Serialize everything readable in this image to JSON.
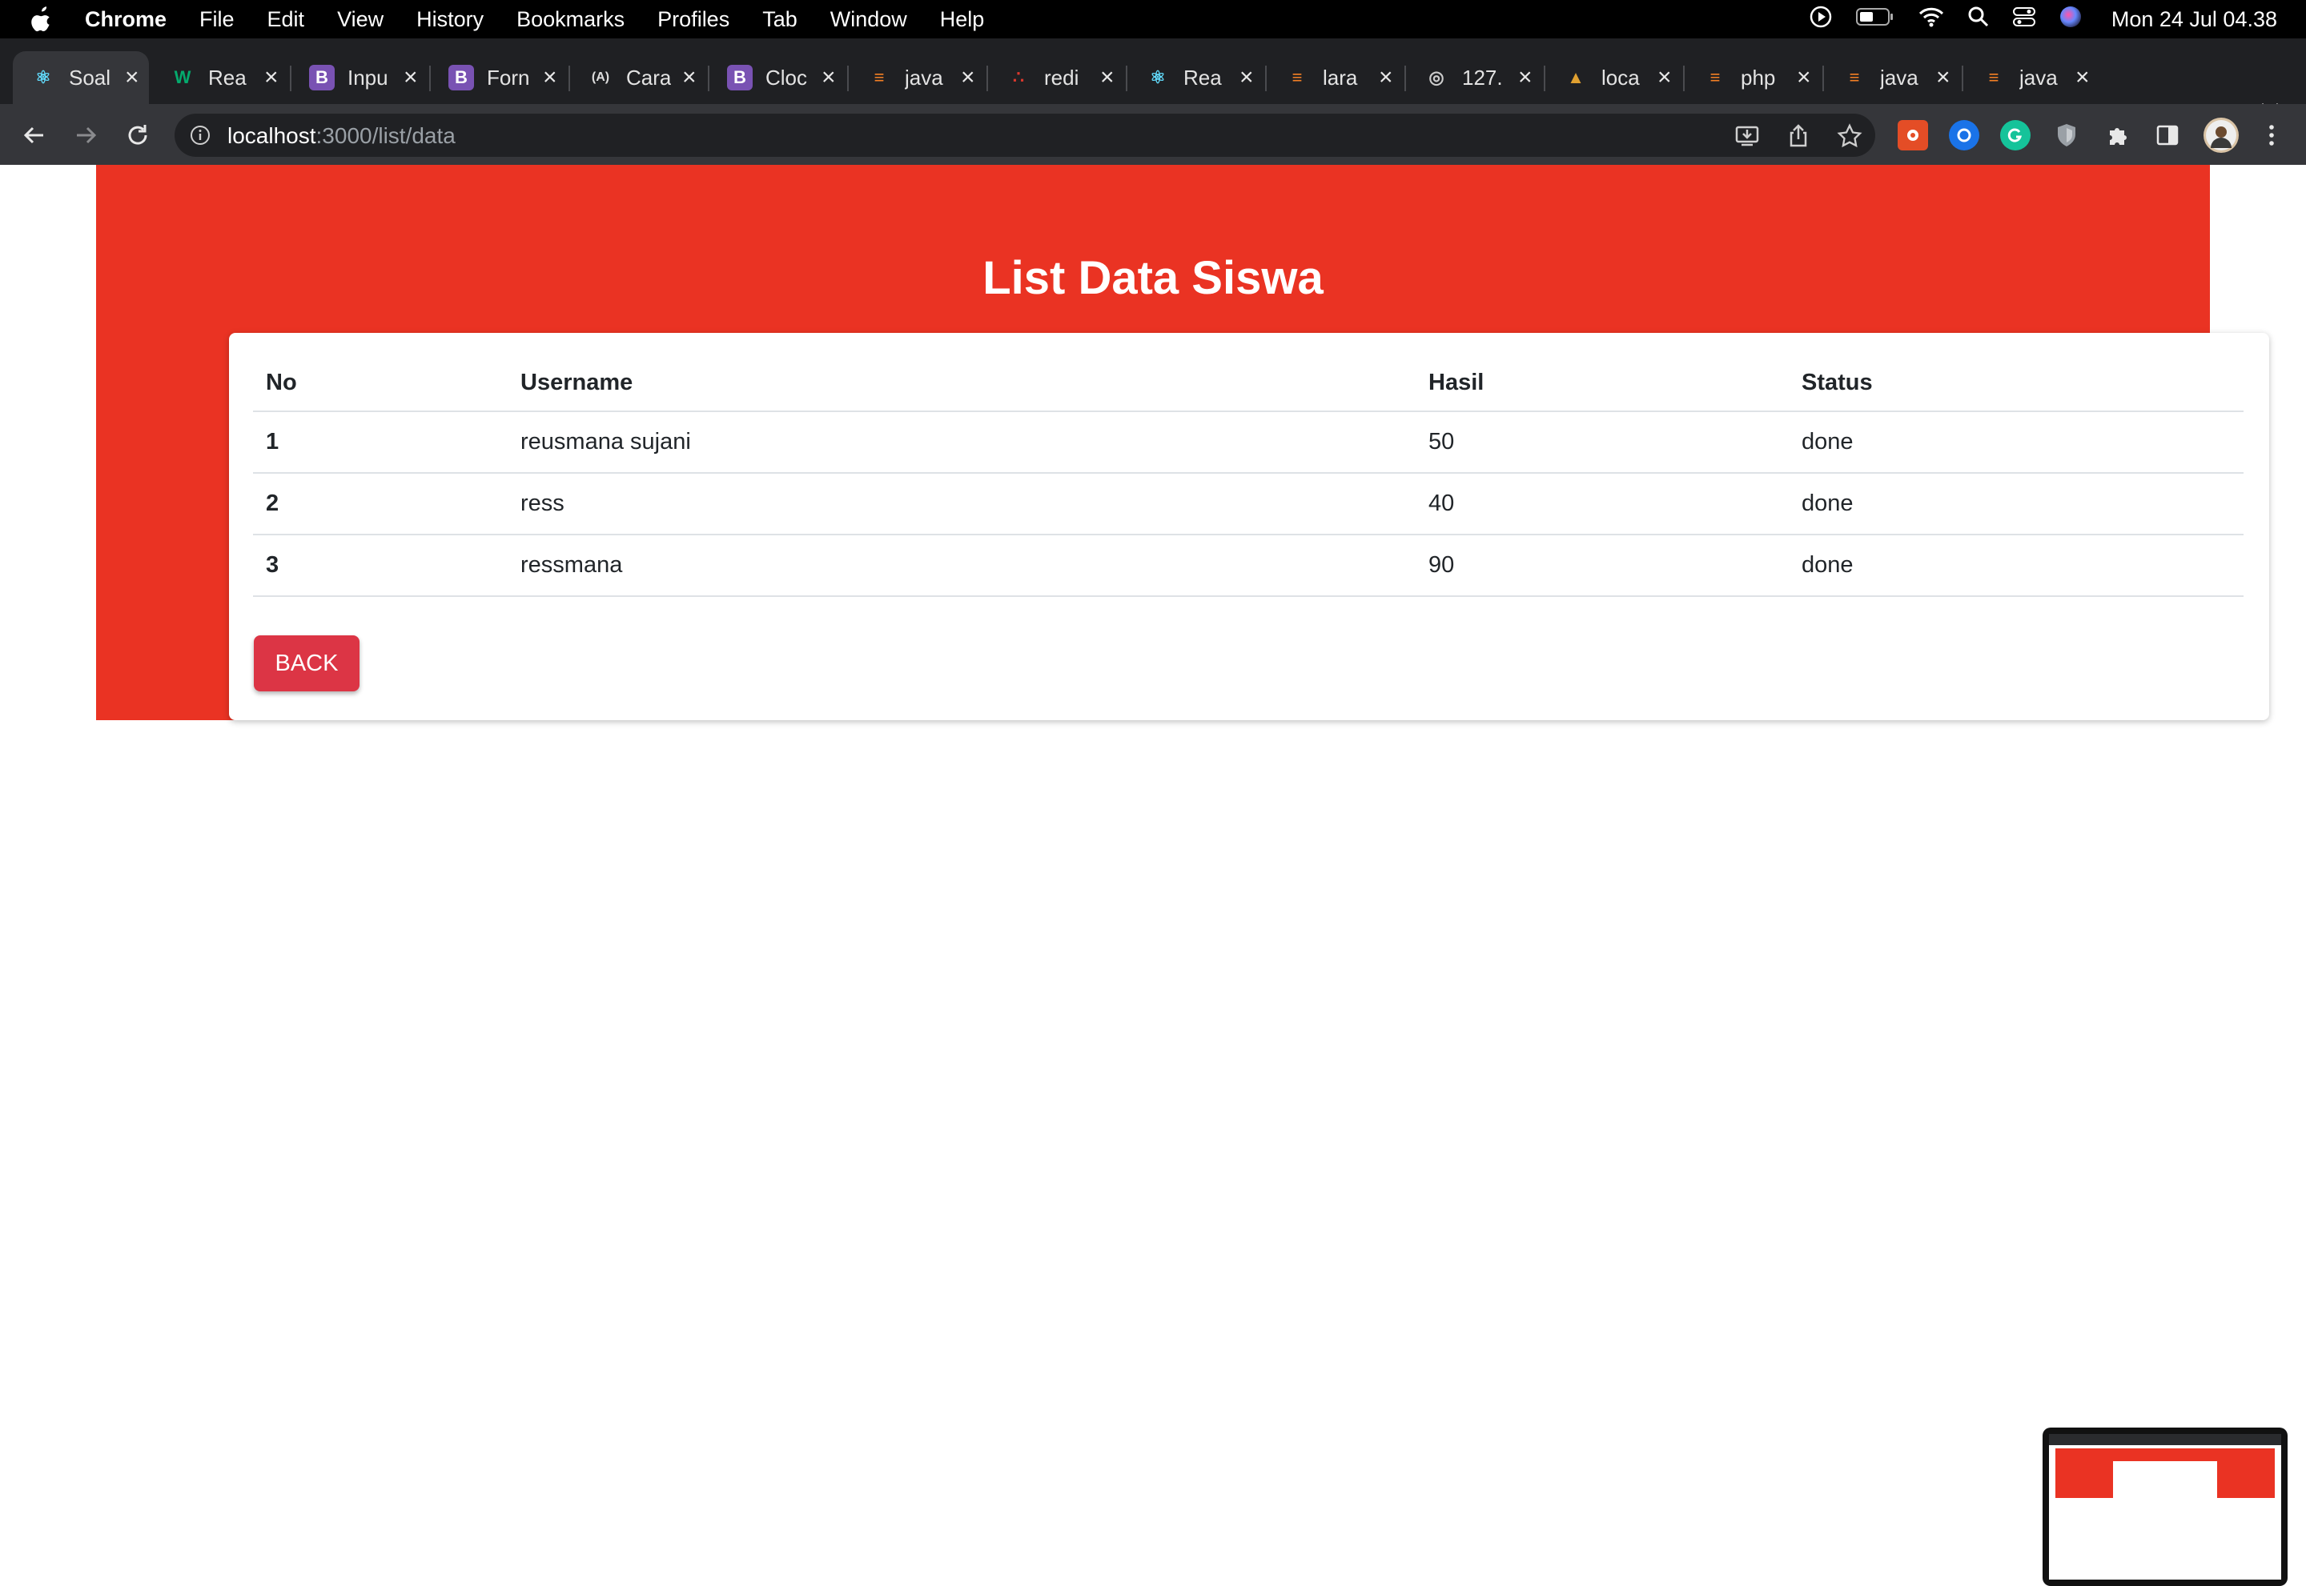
{
  "menubar": {
    "app_name": "Chrome",
    "items": [
      "File",
      "Edit",
      "View",
      "History",
      "Bookmarks",
      "Profiles",
      "Tab",
      "Window",
      "Help"
    ],
    "clock": "Mon 24 Jul  04.38"
  },
  "tabs": [
    {
      "title": "Soal",
      "icon": "react-icon",
      "active": true
    },
    {
      "title": "Rea",
      "icon": "w3-icon"
    },
    {
      "title": "Inpu",
      "icon": "bootstrap-icon"
    },
    {
      "title": "Forn",
      "icon": "bootstrap-icon"
    },
    {
      "title": "Cara",
      "icon": "ajax-icon"
    },
    {
      "title": "Cloc",
      "icon": "bootstrap-icon"
    },
    {
      "title": "java",
      "icon": "stackoverflow-icon"
    },
    {
      "title": "redi",
      "icon": "redis-icon"
    },
    {
      "title": "Rea",
      "icon": "react-icon"
    },
    {
      "title": "lara",
      "icon": "stackoverflow-icon"
    },
    {
      "title": "127.",
      "icon": "globe-icon"
    },
    {
      "title": "loca",
      "icon": "tent-icon"
    },
    {
      "title": "php",
      "icon": "stackoverflow-icon"
    },
    {
      "title": "java",
      "icon": "stackoverflow-icon"
    },
    {
      "title": "java",
      "icon": "stackoverflow-icon"
    }
  ],
  "address_bar": {
    "host": "localhost",
    "path": ":3000/list/data"
  },
  "page": {
    "title": "List Data Siswa",
    "table": {
      "headers": [
        "No",
        "Username",
        "Hasil",
        "Status"
      ],
      "rows": [
        [
          "1",
          "reusmana sujani",
          "50",
          "done"
        ],
        [
          "2",
          "ress",
          "40",
          "done"
        ],
        [
          "3",
          "ressmana",
          "90",
          "done"
        ]
      ]
    },
    "back_label": "BACK"
  },
  "colors": {
    "hero_bg": "#ea3323",
    "button_bg": "#dc3545"
  }
}
